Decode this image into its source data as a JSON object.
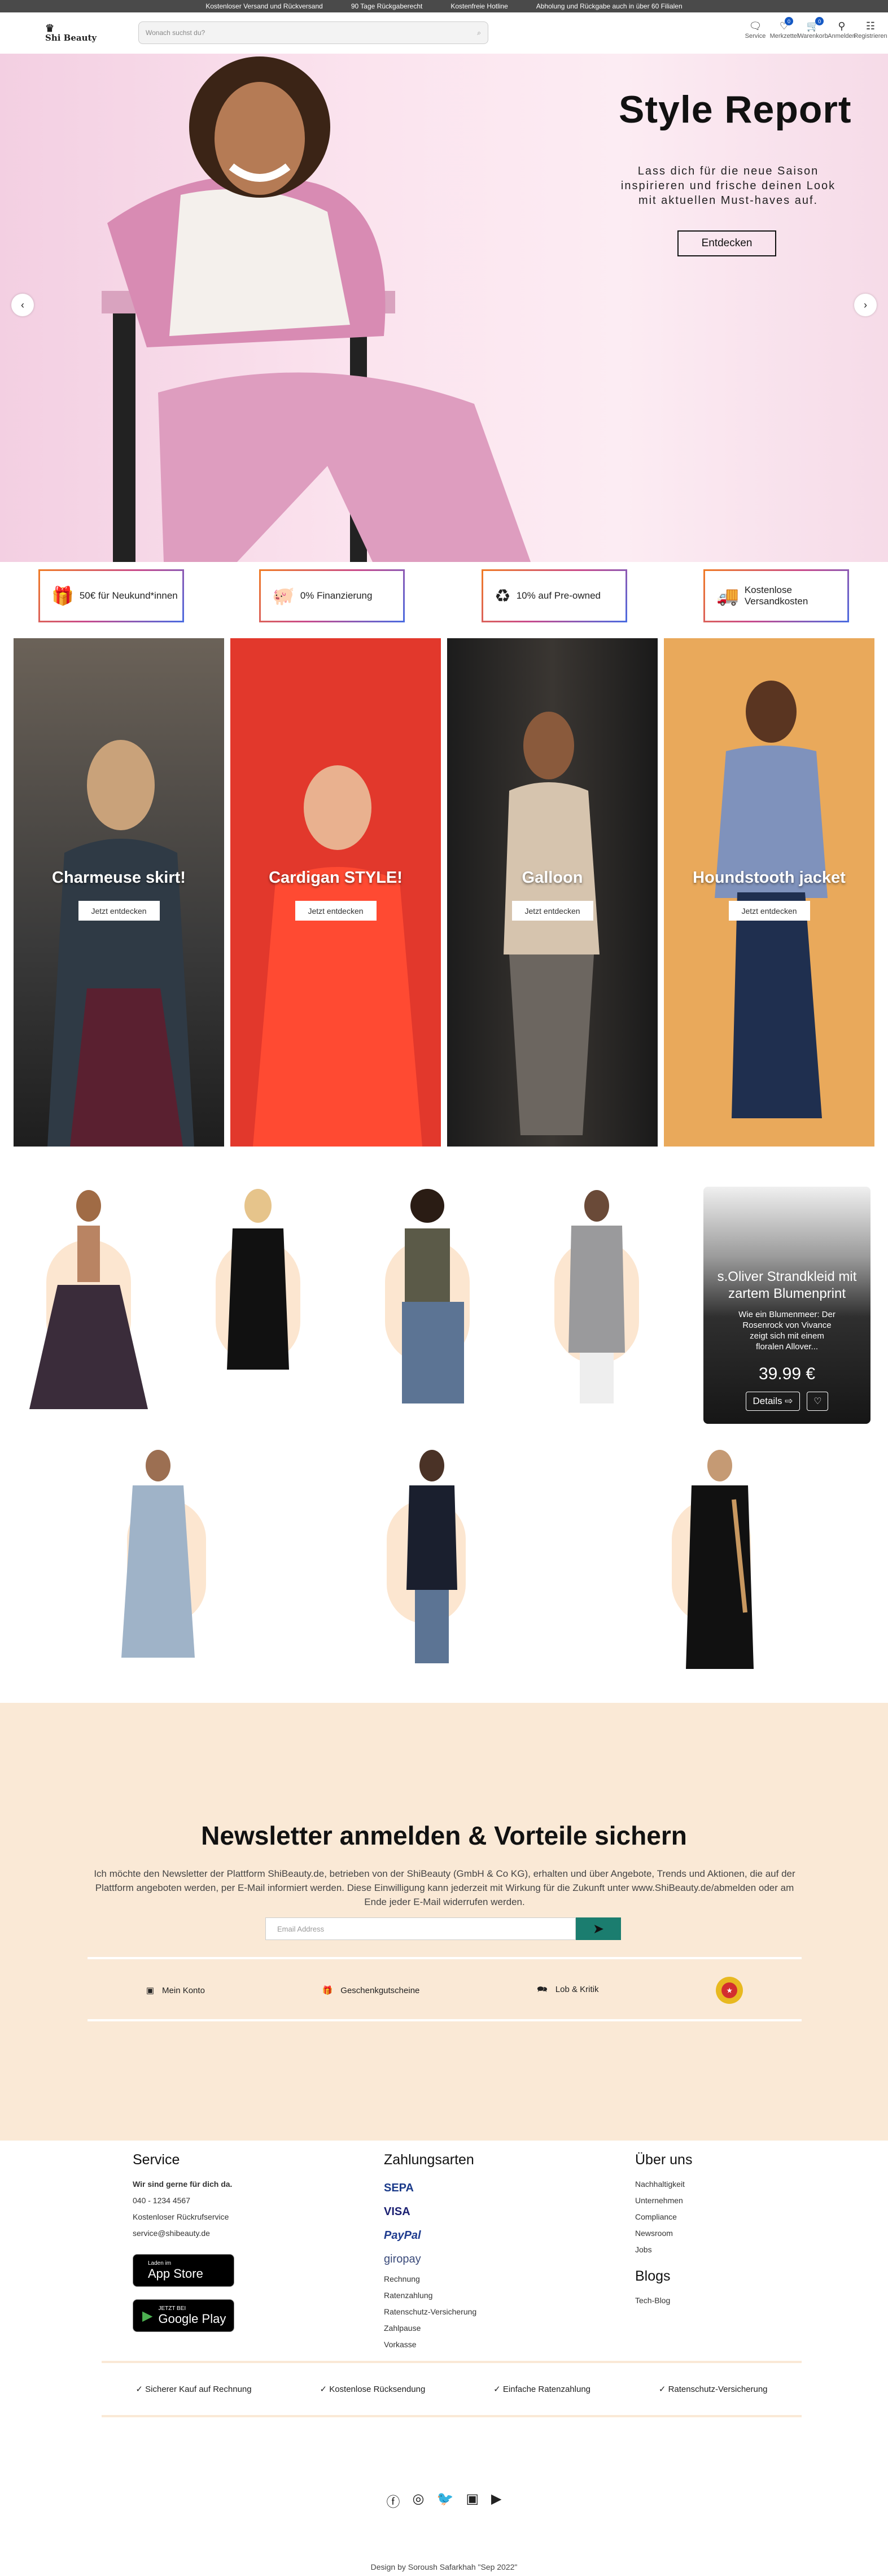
{
  "topbar": [
    "Kostenloser Versand und Rückversand",
    "90 Tage Rückgaberecht",
    "Kostenfreie Hotline",
    "Abholung und Rückgabe auch in über 60 Filialen"
  ],
  "header": {
    "logo": "Shi Beauty",
    "search_placeholder": "Wonach suchst du?",
    "icons": [
      {
        "label": "Service",
        "icon": "chat-icon"
      },
      {
        "label": "Merkzettel",
        "icon": "heart-icon",
        "count": "0"
      },
      {
        "label": "Warenkorb",
        "icon": "cart-icon",
        "count": "0"
      },
      {
        "label": "Anmelden",
        "icon": "user-icon"
      },
      {
        "label": "Registrieren",
        "icon": "register-icon"
      }
    ]
  },
  "hero": {
    "title": "Style Report",
    "text": "Lass dich für die neue Saison inspirieren und frische deinen Look mit aktuellen Must-haves auf.",
    "cta": "Entdecken"
  },
  "benefits": [
    "50€ für Neukund*innen",
    "0% Finanzierung",
    "10% auf Pre-owned",
    "Kostenlose Versandkosten"
  ],
  "promos": [
    {
      "title": "Charmeuse skirt!",
      "button": "Jetzt entdecken"
    },
    {
      "title": "Cardigan STYLE!",
      "button": "Jetzt entdecken"
    },
    {
      "title": "Galloon",
      "button": "Jetzt entdecken"
    },
    {
      "title": "Houndstooth jacket",
      "button": "Jetzt entdecken"
    }
  ],
  "product_card": {
    "title": "s.Oliver Strandkleid mit zartem Blumenprint",
    "desc": "Wie ein Blumenmeer: Der Rosenrock von Vivance zeigt sich mit einem floralen Allover...",
    "price": "39.99 €",
    "details": "Details"
  },
  "newsletter": {
    "title": "Newsletter anmelden & Vorteile sichern",
    "text": "Ich möchte den Newsletter der Plattform ShiBeauty.de, betrieben von der ShiBeauty (GmbH & Co KG), erhalten und über Angebote, Trends und Aktionen, die auf der Plattform angeboten werden, per E-Mail informiert werden. Diese Einwilligung kann jederzeit mit Wirkung für die Zukunft unter www.ShiBeauty.de/abmelden oder am Ende jeder E-Mail widerrufen werden.",
    "placeholder": "Email Address",
    "links": [
      "Mein Konto",
      "Geschenkgutscheine",
      "Lob & Kritik"
    ]
  },
  "footer": {
    "service_title": "Service",
    "service_sub": "Wir sind gerne für dich da.",
    "phone": "040 - 1234 4567",
    "hotline": "Kostenloser Rückrufservice",
    "email": "service@shibeauty.de",
    "appstore_small": "Laden im",
    "appstore": "App Store",
    "gplay_small": "JETZT BEI",
    "gplay": "Google Play",
    "pay_title": "Zahlungsarten",
    "pay_logos": [
      "SEPA",
      "VISA",
      "PayPal",
      "giropay"
    ],
    "pay_links": [
      "Rechnung",
      "Ratenzahlung",
      "Ratenschutz-Versicherung",
      "Zahlpause",
      "Vorkasse"
    ],
    "about_title": "Über uns",
    "about_links": [
      "Nachhaltigkeit",
      "Unternehmen",
      "Compliance",
      "Newsroom",
      "Jobs"
    ],
    "blog_title": "Blogs",
    "blog_links": [
      "Tech-Blog"
    ],
    "trust": [
      "Sicherer Kauf auf Rechnung",
      "Kostenlose Rücksendung",
      "Einfache Ratenzahlung",
      "Ratenschutz-Versicherung"
    ],
    "credit": "Design by Soroush Safarkhah \"Sep 2022\""
  }
}
